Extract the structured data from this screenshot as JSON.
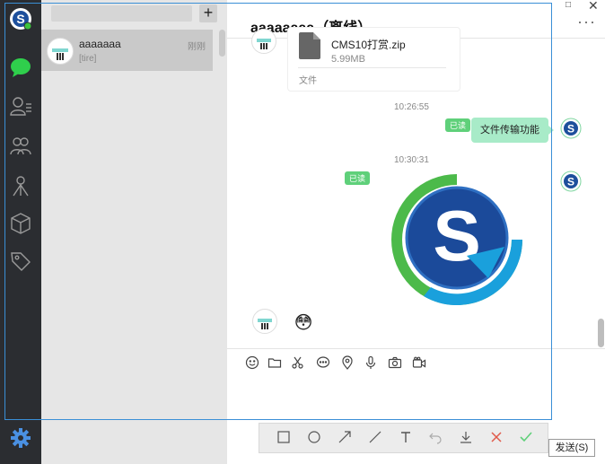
{
  "colors": {
    "rail": "#2b2d31",
    "accent_green": "#5fd07a",
    "bubble": "#a8ebc8",
    "selection_blue": "#3a8fd6"
  },
  "window": {
    "maximize_glyph": "□",
    "close_glyph": "✕"
  },
  "rail": {
    "icons": [
      "app-logo",
      "chat-icon",
      "contacts-icon",
      "group-icon",
      "organization-icon",
      "box-icon",
      "tag-icon",
      "gear-icon"
    ]
  },
  "conv_list": {
    "add_glyph": "+",
    "items": [
      {
        "name": "aaaaaaa",
        "time": "刚刚",
        "preview": "[tire]"
      }
    ]
  },
  "chat": {
    "title": "aaaaaaaa（离线）",
    "more_glyph": "···",
    "file": {
      "name": "CMS10打赏.zip",
      "size": "5.99MB",
      "type": "文件"
    },
    "time1": "10:26:55",
    "read_label": "已读",
    "text_message": "文件传输功能",
    "time2": "10:30:31",
    "emoji": "😳"
  },
  "toolbar": [
    "emoji-icon",
    "folder-icon",
    "scissors-icon",
    "comment-icon",
    "location-icon",
    "microphone-icon",
    "camera-icon",
    "video-icon"
  ],
  "annotation_toolbar": [
    "rectangle-tool",
    "ellipse-tool",
    "arrow-tool",
    "line-tool",
    "text-tool",
    "undo-tool",
    "download-tool",
    "cancel-tool",
    "confirm-tool"
  ],
  "send_label": "发送(S)"
}
